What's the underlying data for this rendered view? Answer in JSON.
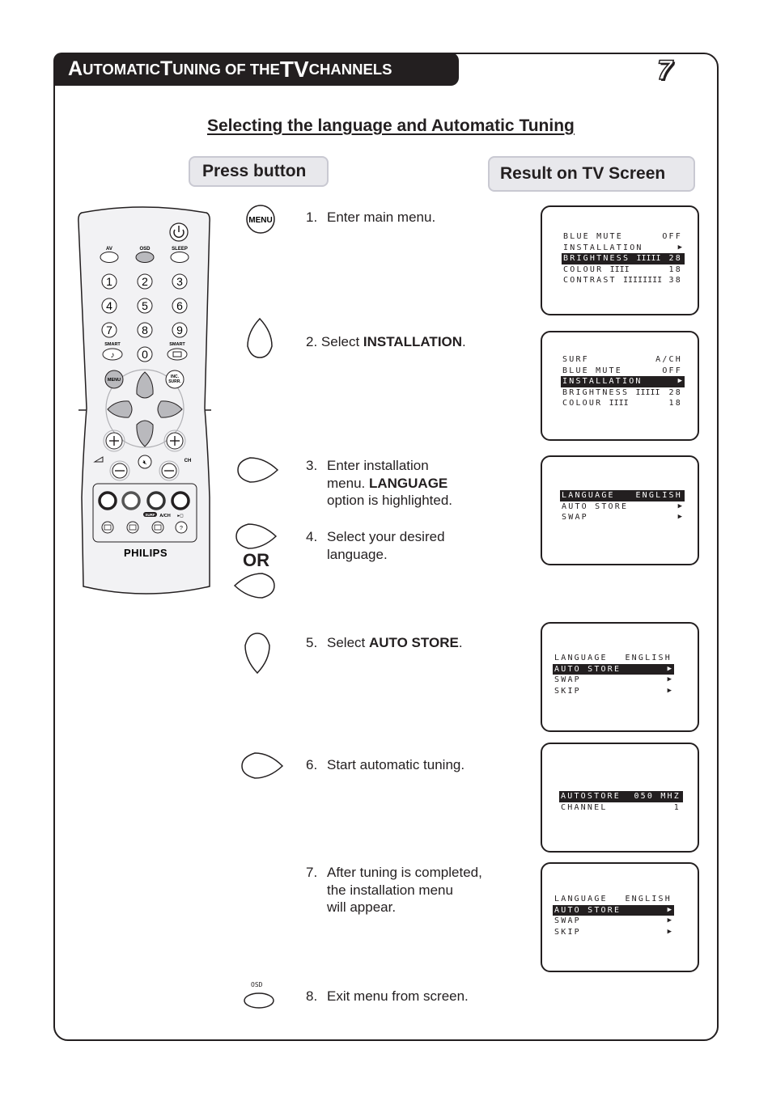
{
  "header": {
    "title_parts": [
      {
        "text": "A",
        "style": "cap"
      },
      {
        "text": "UTOMATIC ",
        "style": "sc"
      },
      {
        "text": "T",
        "style": "cap"
      },
      {
        "text": "UNING OF THE ",
        "style": "sc"
      },
      {
        "text": "TV",
        "style": "big"
      },
      {
        "text": " CHANNELS",
        "style": "sc"
      }
    ],
    "page_number": "7"
  },
  "section_title": "Selecting the language and Automatic Tuning",
  "columns": {
    "press": "Press button",
    "result": "Result on TV Screen"
  },
  "remote": {
    "brand": "PHILIPS",
    "labels": {
      "av": "AV",
      "osd": "OSD",
      "sleep": "SLEEP",
      "smart_left": "SMART",
      "smart_right": "SMART",
      "menu": "MENU",
      "inc_surr_1": "INC.",
      "inc_surr_2": "SURR.",
      "ch": "CH",
      "surf": "SURF",
      "ach": "A/CH"
    },
    "digits": [
      "1",
      "2",
      "3",
      "4",
      "5",
      "6",
      "7",
      "8",
      "9",
      "0"
    ],
    "colors": {
      "body": "#ececef",
      "button_fill": "#c8c8cc",
      "outline": "#231f20"
    }
  },
  "buttons": {
    "menu_label": "MENU",
    "or_label": "OR",
    "osd_label": "OSD"
  },
  "steps": [
    {
      "num": "1.",
      "lines": [
        "Enter main menu."
      ]
    },
    {
      "num": "2.",
      "pre": "Select ",
      "bold": "INSTALLATION",
      "post": "."
    },
    {
      "num": "3.",
      "l1": "Enter installation",
      "l2_pre": "menu. ",
      "l2_bold": "LANGUAGE",
      "l3": "option is highlighted."
    },
    {
      "num": "4.",
      "l1": "Select your desired",
      "l2": "language."
    },
    {
      "num": "5.",
      "pre": "Select ",
      "bold": "AUTO STORE",
      "post": "."
    },
    {
      "num": "6.",
      "lines": [
        "Start automatic tuning."
      ]
    },
    {
      "num": "7.",
      "l1": "After tuning is completed,",
      "l2": "the installation menu",
      "l3": "will appear."
    },
    {
      "num": "8.",
      "lines": [
        "Exit menu from screen."
      ]
    }
  ],
  "screens": [
    {
      "rows": [
        {
          "label": "BLUE MUTE",
          "bars": "",
          "value": "OFF",
          "hl": false
        },
        {
          "label": "INSTALLATION",
          "bars": "",
          "value": "▶",
          "hl": false
        },
        {
          "label": "BRIGHTNESS",
          "bars": "IIIII",
          "value": "28",
          "hl": true
        },
        {
          "label": "COLOUR",
          "bars": "IIII",
          "value": "18",
          "hl": false
        },
        {
          "label": "CONTRAST",
          "bars": "IIIIIIII",
          "value": "38",
          "hl": false
        }
      ]
    },
    {
      "rows": [
        {
          "label": "SURF",
          "bars": "",
          "value": "A/CH",
          "hl": false
        },
        {
          "label": "BLUE MUTE",
          "bars": "",
          "value": "OFF",
          "hl": false
        },
        {
          "label": "INSTALLATION",
          "bars": "",
          "value": "▶",
          "hl": true
        },
        {
          "label": "BRIGHTNESS",
          "bars": "IIIII",
          "value": "28",
          "hl": false
        },
        {
          "label": "COLOUR",
          "bars": "IIII",
          "value": "18",
          "hl": false
        }
      ]
    },
    {
      "rows": [
        {
          "label": "LANGUAGE",
          "bars": "",
          "value": "ENGLISH",
          "hl": true
        },
        {
          "label": "AUTO STORE",
          "bars": "",
          "value": "▶",
          "hl": false
        },
        {
          "label": "SWAP",
          "bars": "",
          "value": "▶",
          "hl": false
        }
      ]
    },
    {
      "rows": [
        {
          "label": "LANGUAGE",
          "bars": "",
          "value": "ENGLISH",
          "hl": false
        },
        {
          "label": "AUTO STORE",
          "bars": "",
          "value": "▶",
          "hl": true
        },
        {
          "label": "SWAP",
          "bars": "",
          "value": "▶",
          "hl": false
        },
        {
          "label": "SKIP",
          "bars": "",
          "value": "▶",
          "hl": false
        }
      ]
    },
    {
      "rows": [
        {
          "label": "AUTOSTORE",
          "bars": "",
          "value": "050 MHZ",
          "hl": true
        },
        {
          "label": "CHANNEL",
          "bars": "",
          "value": "1",
          "hl": false
        }
      ]
    },
    {
      "rows": [
        {
          "label": "LANGUAGE",
          "bars": "",
          "value": "ENGLISH",
          "hl": false
        },
        {
          "label": "AUTO STORE",
          "bars": "",
          "value": "▶",
          "hl": true
        },
        {
          "label": "SWAP",
          "bars": "",
          "value": "▶",
          "hl": false
        },
        {
          "label": "SKIP",
          "bars": "",
          "value": "▶",
          "hl": false
        }
      ]
    }
  ]
}
